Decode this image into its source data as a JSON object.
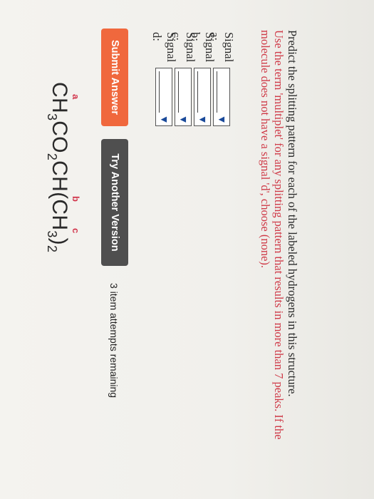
{
  "structure": {
    "formula_parts": [
      "CH",
      "3",
      "CO",
      "2",
      "CH(CH",
      "3",
      ")",
      "2"
    ],
    "labels": {
      "a": "a",
      "b": "b",
      "c": "c"
    }
  },
  "question": {
    "text": "Predict the splitting pattern for each of the labeled hydrogens in this structure.",
    "warning": "Use the term 'multiplet' for any splitting pattern that results in more than 7 peaks. If the molecule does not have a signal 'd', choose (none)."
  },
  "signals": [
    {
      "label": "Signal a:",
      "value": ""
    },
    {
      "label": "Signal b:",
      "value": ""
    },
    {
      "label": "Signal c:",
      "value": ""
    },
    {
      "label": "Signal d:",
      "value": ""
    }
  ],
  "dropdown_arrow": "▼",
  "buttons": {
    "submit": "Submit Answer",
    "try_another": "Try Another Version"
  },
  "attempts": "3 item attempts remaining",
  "colors": {
    "submit": "#f0683d",
    "try_another": "#4f4f4f",
    "label_red": "#d2384e"
  }
}
